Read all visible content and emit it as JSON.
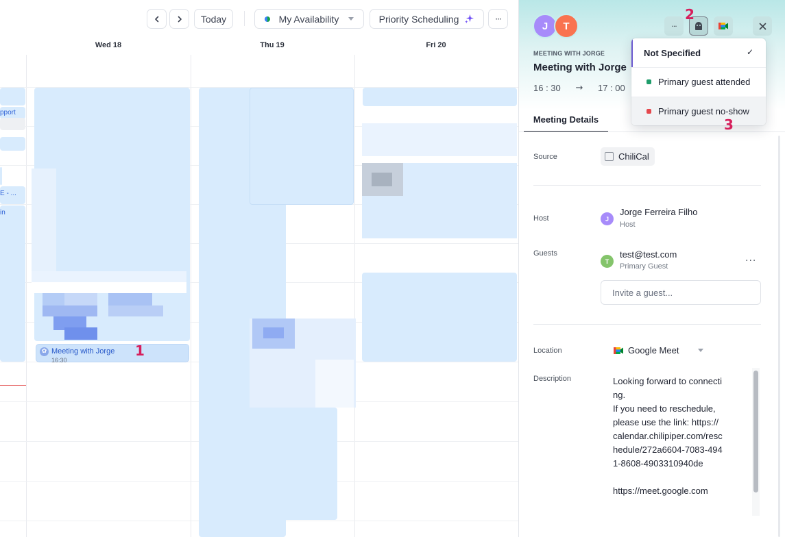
{
  "toolbar": {
    "prev_icon": "chevron-left-icon",
    "next_icon": "chevron-right-icon",
    "today_label": "Today",
    "availability_label": "My Availability",
    "priority_label": "Priority Scheduling",
    "more_label": "···"
  },
  "calendar": {
    "days": [
      "Wed 18",
      "Thu 19",
      "Fri 20"
    ],
    "side_labels": [
      "pport",
      "E - ...",
      "in"
    ],
    "event": {
      "title": "Meeting with Jorge",
      "time": "16:30"
    }
  },
  "annotations": [
    "1",
    "2",
    "3"
  ],
  "panel": {
    "avatars": [
      {
        "initial": "J",
        "color": "#a78bfa"
      },
      {
        "initial": "T",
        "color": "#f97350"
      }
    ],
    "kicker": "MEETING WITH JORGE",
    "title": "Meeting with Jorge",
    "start_time": "16 : 30",
    "end_time": "17 : 00",
    "arrow": "→",
    "tab_label": "Meeting Details",
    "source": {
      "label": "Source",
      "value": "ChiliCal"
    },
    "host": {
      "label": "Host",
      "name": "Jorge Ferreira Filho",
      "role": "Host",
      "initial": "J",
      "color": "#a78bfa"
    },
    "guests": {
      "label": "Guests",
      "name": "test@test.com",
      "role": "Primary Guest",
      "initial": "T",
      "color": "#84c46b",
      "more": "···",
      "invite_placeholder": "Invite a guest..."
    },
    "location": {
      "label": "Location",
      "value": "Google Meet"
    },
    "description": {
      "label": "Description",
      "text": "Looking forward to connecting.\nIf you need to reschedule, please use the link: https://calendar.chilipiper.com/reschedule/272a6604-7083-4941-8608-4903310940de\n\nhttps://meet.google.com"
    }
  },
  "attendance_menu": {
    "options": [
      {
        "label": "Not Specified",
        "selected": true
      },
      {
        "label": "Primary guest attended",
        "dot_color": "#1f9d6b"
      },
      {
        "label": "Primary guest no-show",
        "dot_color": "#e5484d"
      }
    ],
    "check": "✓"
  },
  "colors": {
    "accent": "#6d5bd0",
    "event_fill": "#d8ebfd",
    "event_text": "#2456c8",
    "annotation": "#d61f5c"
  }
}
